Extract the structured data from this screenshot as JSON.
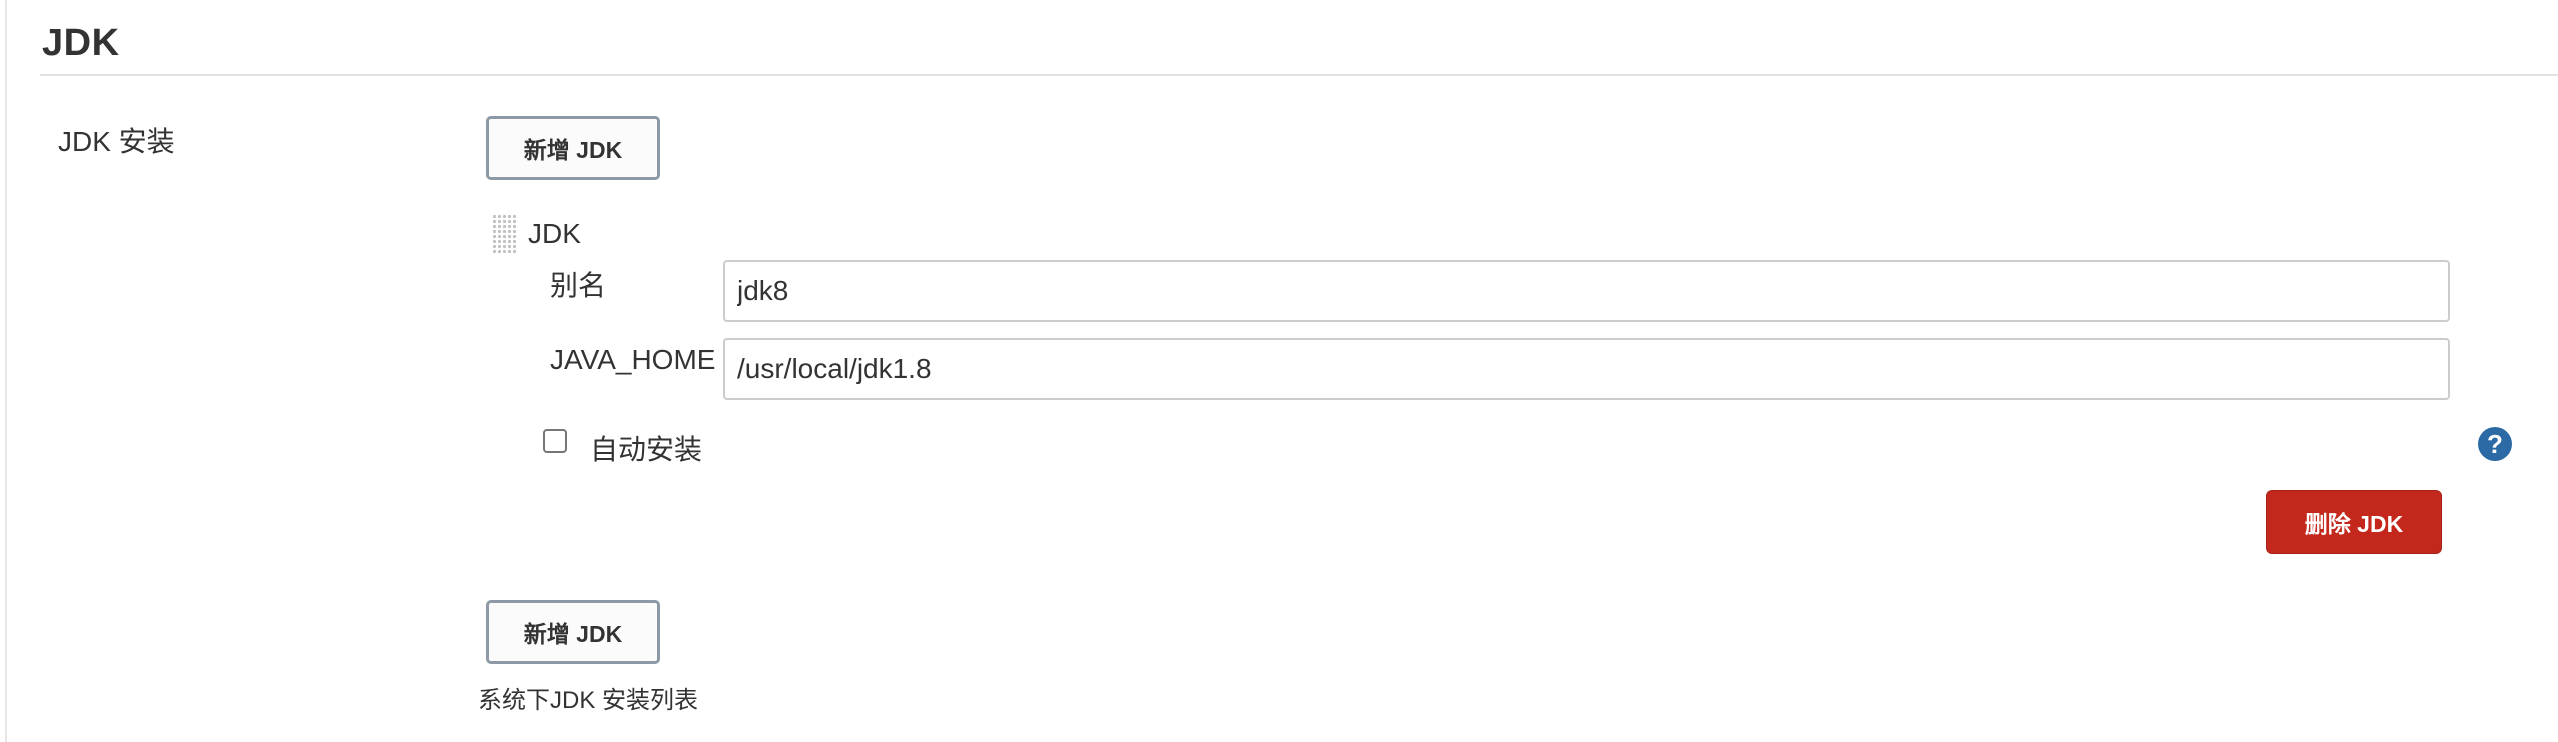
{
  "section": {
    "title": "JDK"
  },
  "jdk_installations": {
    "label": "JDK 安装",
    "add_button_label": "新增 JDK",
    "description": "系统下JDK 安装列表",
    "items": [
      {
        "header": "JDK",
        "name_label": "别名",
        "name_value": "jdk8",
        "java_home_label": "JAVA_HOME",
        "java_home_value": "/usr/local/jdk1.8",
        "auto_install_label": "自动安装",
        "auto_install_checked": false,
        "help_icon": "?",
        "delete_button_label": "删除 JDK"
      }
    ]
  },
  "icons": {
    "drag_handle": "drag-handle-icon",
    "help": "question-circle-icon"
  },
  "colors": {
    "danger_button": "#c4281c",
    "help_icon": "#2b6aa5",
    "outline_button_border": "#8d99a6"
  }
}
